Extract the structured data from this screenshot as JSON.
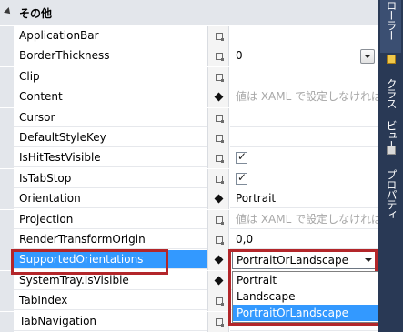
{
  "category": {
    "title": "その他"
  },
  "properties": [
    {
      "name": "ApplicationBar",
      "marker": "square",
      "value": ""
    },
    {
      "name": "BorderThickness",
      "marker": "square",
      "value": "0",
      "control": "dropdown"
    },
    {
      "name": "Clip",
      "marker": "square",
      "value": ""
    },
    {
      "name": "Content",
      "marker": "diamond",
      "value": "値は XAML で設定しなければなりません",
      "muted": true
    },
    {
      "name": "Cursor",
      "marker": "square",
      "value": ""
    },
    {
      "name": "DefaultStyleKey",
      "marker": "square",
      "value": ""
    },
    {
      "name": "IsHitTestVisible",
      "marker": "square",
      "value": "",
      "control": "checkbox",
      "checked": true
    },
    {
      "name": "IsTabStop",
      "marker": "square",
      "value": "",
      "control": "checkbox",
      "checked": true
    },
    {
      "name": "Orientation",
      "marker": "diamond",
      "value": "Portrait"
    },
    {
      "name": "Projection",
      "marker": "square",
      "value": "値は XAML で設定しなければなりません",
      "muted": true
    },
    {
      "name": "RenderTransformOrigin",
      "marker": "square",
      "value": "0,0"
    },
    {
      "name": "SupportedOrientations",
      "marker": "diamond",
      "value": "PortraitOrLandscape",
      "control": "combo",
      "selected": true
    },
    {
      "name": "SystemTray.IsVisible",
      "marker": "diamond",
      "value": ""
    },
    {
      "name": "TabIndex",
      "marker": "square",
      "value": ""
    },
    {
      "name": "TabNavigation",
      "marker": "square",
      "value": ""
    }
  ],
  "dropdown": {
    "options": [
      "Portrait",
      "Landscape",
      "PortraitOrLandscape"
    ],
    "highlighted": "PortraitOrLandscape"
  },
  "sidebar": {
    "tabs": [
      {
        "label": "ローラー",
        "icon": ""
      },
      {
        "label": "クラス ビュー",
        "icon": "class-view-icon"
      },
      {
        "label": "プロパティ",
        "icon": "properties-icon"
      }
    ]
  },
  "colors": {
    "selection": "#3399ff",
    "highlight_box": "#b3262a",
    "sidebar": "#293955"
  }
}
